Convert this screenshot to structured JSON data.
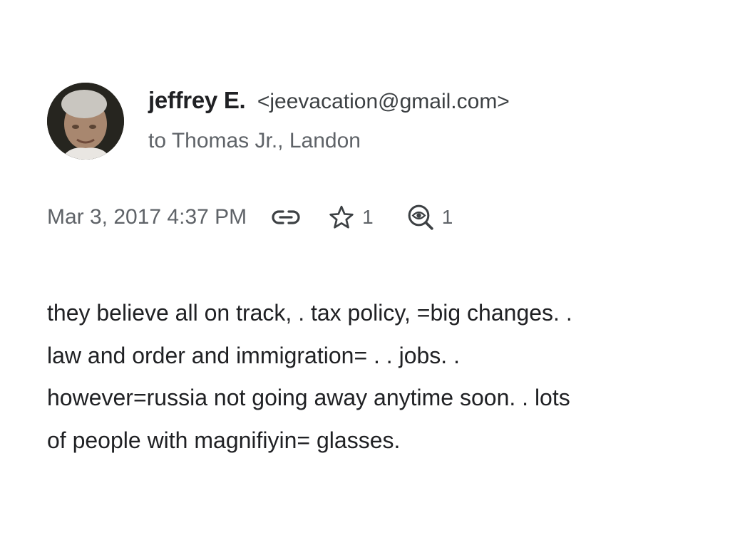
{
  "sender": {
    "name": "jeffrey E.",
    "email": "<jeevacation@gmail.com>",
    "recipients": "to Thomas Jr., Landon"
  },
  "meta": {
    "timestamp": "Mar 3, 2017 4:37 PM",
    "star_count": "1",
    "view_count": "1",
    "link_icon": "link-icon",
    "star_icon": "star-icon",
    "view_icon": "magnifier-eye-icon"
  },
  "message": {
    "lines": [
      "they believe all on track, . tax policy, =big changes. .",
      "law and order and immigration= . . jobs. .",
      "however=russia not going away anytime soon. . lots",
      "of people with magnifiyin= glasses."
    ]
  },
  "colors": {
    "text": "#202124",
    "secondary": "#5f6368",
    "background": "#ffffff"
  }
}
